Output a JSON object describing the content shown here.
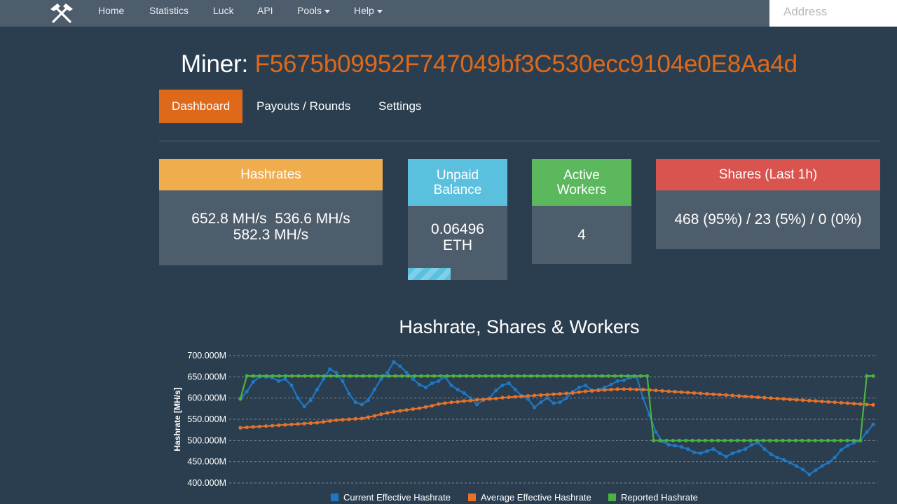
{
  "nav": {
    "items": [
      {
        "label": "Home"
      },
      {
        "label": "Statistics"
      },
      {
        "label": "Luck"
      },
      {
        "label": "API"
      },
      {
        "label": "Pools"
      },
      {
        "label": "Help"
      }
    ],
    "search_placeholder": "Address"
  },
  "miner": {
    "label": "Miner:",
    "address": "F5675b09952F747049bf3C530ecc9104e0E8Aa4d"
  },
  "tabs": [
    {
      "label": "Dashboard",
      "active": true
    },
    {
      "label": "Payouts / Rounds",
      "active": false
    },
    {
      "label": "Settings",
      "active": false
    }
  ],
  "panels": {
    "hashrates": {
      "title": "Hashrates",
      "line1": "652.8 MH/s  536.6 MH/s",
      "line2": "582.3 MH/s",
      "color": "#f0ad4e"
    },
    "balance": {
      "title_line1": "Unpaid",
      "title_line2": "Balance",
      "value_line1": "0.06496",
      "value_line2": "ETH",
      "progress": 0.43,
      "color": "#5bc0de"
    },
    "workers": {
      "title_line1": "Active",
      "title_line2": "Workers",
      "value": "4",
      "color": "#5cb85c"
    },
    "shares": {
      "title": "Shares (Last 1h)",
      "value": "468 (95%) / 23 (5%) / 0 (0%)",
      "color": "#d9534f"
    }
  },
  "chart_title": "Hashrate, Shares & Workers",
  "chart_data": {
    "type": "line",
    "ylabel": "Hashrate [MH/s]",
    "ylim": [
      400,
      700
    ],
    "yticks": [
      {
        "value": 700,
        "label": "700.000M"
      },
      {
        "value": 650,
        "label": "650.000M"
      },
      {
        "value": 600,
        "label": "600.000M"
      },
      {
        "value": 550,
        "label": "550.000M"
      },
      {
        "value": 500,
        "label": "500.000M"
      },
      {
        "value": 450,
        "label": "450.000M"
      },
      {
        "value": 400,
        "label": "400.000M"
      }
    ],
    "grid": true,
    "legend_position": "bottom",
    "series": [
      {
        "name": "Current Effective Hashrate",
        "color": "#1f77c4",
        "values": [
          598,
          615,
          638,
          650,
          650,
          648,
          640,
          645,
          630,
          600,
          580,
          595,
          620,
          645,
          668,
          660,
          640,
          610,
          590,
          585,
          595,
          620,
          645,
          660,
          685,
          675,
          660,
          645,
          632,
          625,
          635,
          640,
          650,
          630,
          620,
          612,
          600,
          585,
          595,
          600,
          618,
          630,
          635,
          620,
          605,
          598,
          578,
          590,
          600,
          588,
          590,
          600,
          615,
          625,
          630,
          618,
          620,
          625,
          632,
          640,
          642,
          648,
          650,
          600,
          560,
          520,
          498,
          490,
          488,
          485,
          480,
          472,
          470,
          475,
          480,
          470,
          462,
          470,
          475,
          480,
          490,
          495,
          480,
          468,
          460,
          455,
          448,
          440,
          432,
          420,
          430,
          440,
          448,
          460,
          478,
          488,
          495,
          500,
          520,
          538
        ]
      },
      {
        "name": "Average Effective Hashrate",
        "color": "#e8712a",
        "values": [
          530,
          531,
          532,
          533,
          534,
          535,
          536,
          537,
          538,
          539,
          540,
          541,
          542,
          544,
          546,
          548,
          549,
          550,
          551,
          552,
          555,
          558,
          562,
          565,
          568,
          570,
          572,
          574,
          576,
          579,
          582,
          586,
          588,
          590,
          591,
          593,
          594,
          596,
          597,
          598,
          599,
          601,
          602,
          603,
          604,
          605,
          606,
          607,
          608,
          609,
          610,
          611,
          612,
          614,
          616,
          617,
          618,
          619,
          620,
          621,
          621,
          621,
          620,
          620,
          619,
          618,
          617,
          616,
          615,
          614,
          613,
          612,
          611,
          610,
          609,
          608,
          607,
          606,
          605,
          604,
          603,
          602,
          601,
          600,
          599,
          598,
          597,
          596,
          595,
          594,
          593,
          592,
          591,
          590,
          589,
          588,
          587,
          586,
          585,
          584
        ]
      },
      {
        "name": "Reported Hashrate",
        "color": "#4bb33f",
        "values": [
          598,
          652,
          652,
          652,
          652,
          652,
          652,
          652,
          652,
          652,
          652,
          652,
          652,
          652,
          652,
          652,
          652,
          652,
          652,
          652,
          652,
          652,
          652,
          652,
          652,
          652,
          652,
          652,
          652,
          652,
          652,
          652,
          652,
          652,
          652,
          652,
          652,
          652,
          652,
          652,
          652,
          652,
          652,
          652,
          652,
          652,
          652,
          652,
          652,
          652,
          652,
          652,
          652,
          652,
          652,
          652,
          652,
          652,
          652,
          652,
          652,
          652,
          652,
          652,
          500,
          500,
          500,
          500,
          500,
          500,
          500,
          500,
          500,
          500,
          500,
          500,
          500,
          500,
          500,
          500,
          500,
          500,
          500,
          500,
          500,
          500,
          500,
          500,
          500,
          500,
          500,
          500,
          500,
          500,
          500,
          500,
          500,
          652,
          652
        ]
      }
    ]
  }
}
